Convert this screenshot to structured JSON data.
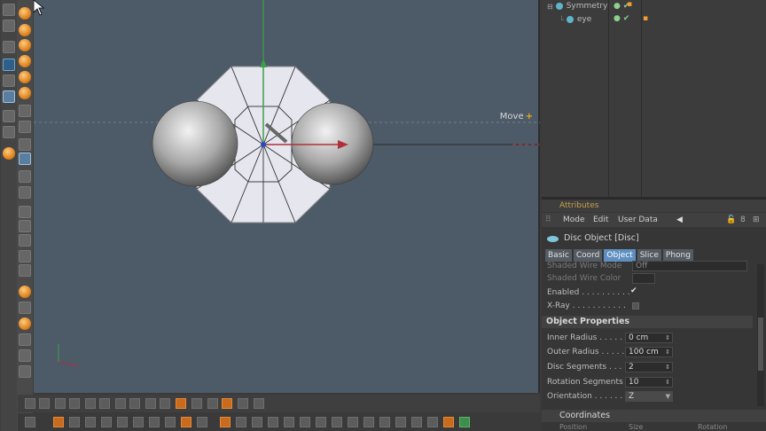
{
  "object_manager": {
    "items": [
      {
        "label": "Symmetry"
      },
      {
        "label": "eye"
      }
    ]
  },
  "viewport": {
    "move_label": "Move",
    "move_plus": "+"
  },
  "attributes": {
    "panel_title": "Attributes",
    "menu": {
      "mode": "Mode",
      "edit": "Edit",
      "user_data": "User Data"
    },
    "object_name": "Disc Object [Disc]",
    "tabs": [
      "Basic",
      "Coord",
      "Object",
      "Slice",
      "Phong"
    ],
    "active_tab": "Object",
    "props_top": [
      {
        "label": "Shaded Wire Mode",
        "value": "Off"
      },
      {
        "label": "Shaded Wire Color",
        "value": ""
      },
      {
        "label": "Enabled . . . . . . . . . .",
        "value": "✔"
      },
      {
        "label": "X-Ray . . . . . . . . . . .",
        "value": ""
      }
    ],
    "section_object_props": "Object Properties",
    "object_props": [
      {
        "label": "Inner Radius . . . . .",
        "value": "0 cm"
      },
      {
        "label": "Outer Radius . . . . .",
        "value": "100 cm"
      },
      {
        "label": "Disc Segments . . . .",
        "value": "2"
      },
      {
        "label": "Rotation Segments",
        "value": "10"
      },
      {
        "label": "Orientation . . . . . .",
        "value": "Z"
      }
    ],
    "section_coordinates": "Coordinates",
    "coord_headers": [
      "Position",
      "Size",
      "Rotation"
    ]
  }
}
